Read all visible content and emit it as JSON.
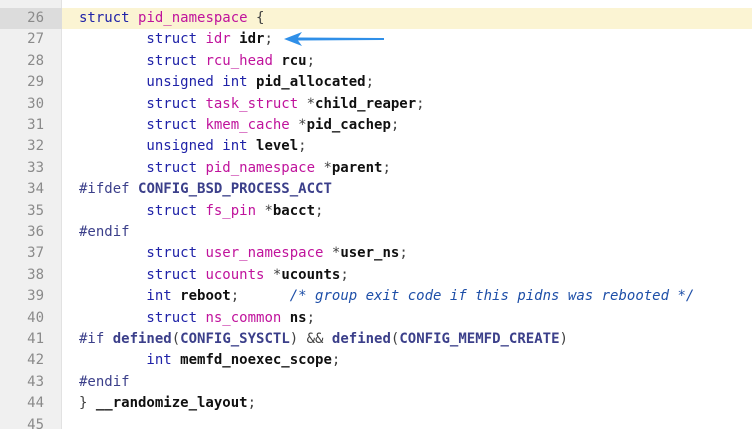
{
  "editor": {
    "highlighted_line": "26",
    "accent_color": "#2f8fe8",
    "lines": [
      {
        "n": "26",
        "tokens": [
          {
            "t": "struct ",
            "c": "kw"
          },
          {
            "t": "pid_namespace",
            "c": "ty"
          },
          {
            "t": " {",
            "c": "op"
          }
        ]
      },
      {
        "n": "27",
        "tokens": [
          {
            "t": "        struct ",
            "c": "kw"
          },
          {
            "t": "idr",
            "c": "ty"
          },
          {
            "t": " ",
            "c": "op"
          },
          {
            "t": "idr",
            "c": "id"
          },
          {
            "t": ";",
            "c": "op"
          }
        ]
      },
      {
        "n": "28",
        "tokens": [
          {
            "t": "        struct ",
            "c": "kw"
          },
          {
            "t": "rcu_head",
            "c": "ty"
          },
          {
            "t": " ",
            "c": "op"
          },
          {
            "t": "rcu",
            "c": "id"
          },
          {
            "t": ";",
            "c": "op"
          }
        ]
      },
      {
        "n": "29",
        "tokens": [
          {
            "t": "        unsigned int ",
            "c": "kw"
          },
          {
            "t": "pid_allocated",
            "c": "id"
          },
          {
            "t": ";",
            "c": "op"
          }
        ]
      },
      {
        "n": "30",
        "tokens": [
          {
            "t": "        struct ",
            "c": "kw"
          },
          {
            "t": "task_struct",
            "c": "ty"
          },
          {
            "t": " *",
            "c": "op"
          },
          {
            "t": "child_reaper",
            "c": "id"
          },
          {
            "t": ";",
            "c": "op"
          }
        ]
      },
      {
        "n": "31",
        "tokens": [
          {
            "t": "        struct ",
            "c": "kw"
          },
          {
            "t": "kmem_cache",
            "c": "ty"
          },
          {
            "t": " *",
            "c": "op"
          },
          {
            "t": "pid_cachep",
            "c": "id"
          },
          {
            "t": ";",
            "c": "op"
          }
        ]
      },
      {
        "n": "32",
        "tokens": [
          {
            "t": "        unsigned int ",
            "c": "kw"
          },
          {
            "t": "level",
            "c": "id"
          },
          {
            "t": ";",
            "c": "op"
          }
        ]
      },
      {
        "n": "33",
        "tokens": [
          {
            "t": "        struct ",
            "c": "kw"
          },
          {
            "t": "pid_namespace",
            "c": "ty"
          },
          {
            "t": " *",
            "c": "op"
          },
          {
            "t": "parent",
            "c": "id"
          },
          {
            "t": ";",
            "c": "op"
          }
        ]
      },
      {
        "n": "34",
        "tokens": [
          {
            "t": "#ifdef ",
            "c": "pp"
          },
          {
            "t": "CONFIG_BSD_PROCESS_ACCT",
            "c": "mac"
          }
        ]
      },
      {
        "n": "35",
        "tokens": [
          {
            "t": "        struct ",
            "c": "kw"
          },
          {
            "t": "fs_pin",
            "c": "ty"
          },
          {
            "t": " *",
            "c": "op"
          },
          {
            "t": "bacct",
            "c": "id"
          },
          {
            "t": ";",
            "c": "op"
          }
        ]
      },
      {
        "n": "36",
        "tokens": [
          {
            "t": "#endif",
            "c": "pp"
          }
        ]
      },
      {
        "n": "37",
        "tokens": [
          {
            "t": "        struct ",
            "c": "kw"
          },
          {
            "t": "user_namespace",
            "c": "ty"
          },
          {
            "t": " *",
            "c": "op"
          },
          {
            "t": "user_ns",
            "c": "id"
          },
          {
            "t": ";",
            "c": "op"
          }
        ]
      },
      {
        "n": "38",
        "tokens": [
          {
            "t": "        struct ",
            "c": "kw"
          },
          {
            "t": "ucounts",
            "c": "ty"
          },
          {
            "t": " *",
            "c": "op"
          },
          {
            "t": "ucounts",
            "c": "id"
          },
          {
            "t": ";",
            "c": "op"
          }
        ]
      },
      {
        "n": "39",
        "tokens": [
          {
            "t": "        int ",
            "c": "kw"
          },
          {
            "t": "reboot",
            "c": "id"
          },
          {
            "t": ";      ",
            "c": "op"
          },
          {
            "t": "/* group exit code if this pidns was rebooted */",
            "c": "cm"
          }
        ]
      },
      {
        "n": "40",
        "tokens": [
          {
            "t": "        struct ",
            "c": "kw"
          },
          {
            "t": "ns_common",
            "c": "ty"
          },
          {
            "t": " ",
            "c": "op"
          },
          {
            "t": "ns",
            "c": "id"
          },
          {
            "t": ";",
            "c": "op"
          }
        ]
      },
      {
        "n": "41",
        "tokens": [
          {
            "t": "#if ",
            "c": "pp"
          },
          {
            "t": "defined",
            "c": "mac"
          },
          {
            "t": "(",
            "c": "op"
          },
          {
            "t": "CONFIG_SYSCTL",
            "c": "mac"
          },
          {
            "t": ") && ",
            "c": "op"
          },
          {
            "t": "defined",
            "c": "mac"
          },
          {
            "t": "(",
            "c": "op"
          },
          {
            "t": "CONFIG_MEMFD_CREATE",
            "c": "mac"
          },
          {
            "t": ")",
            "c": "op"
          }
        ]
      },
      {
        "n": "42",
        "tokens": [
          {
            "t": "        int ",
            "c": "kw"
          },
          {
            "t": "memfd_noexec_scope",
            "c": "id"
          },
          {
            "t": ";",
            "c": "op"
          }
        ]
      },
      {
        "n": "43",
        "tokens": [
          {
            "t": "#endif",
            "c": "pp"
          }
        ]
      },
      {
        "n": "44",
        "tokens": [
          {
            "t": "} ",
            "c": "op"
          },
          {
            "t": "__randomize_layout",
            "c": "id"
          },
          {
            "t": ";",
            "c": "op"
          }
        ]
      },
      {
        "n": "45",
        "tokens": []
      }
    ]
  },
  "annotation": {
    "icon": "arrow-icon"
  }
}
